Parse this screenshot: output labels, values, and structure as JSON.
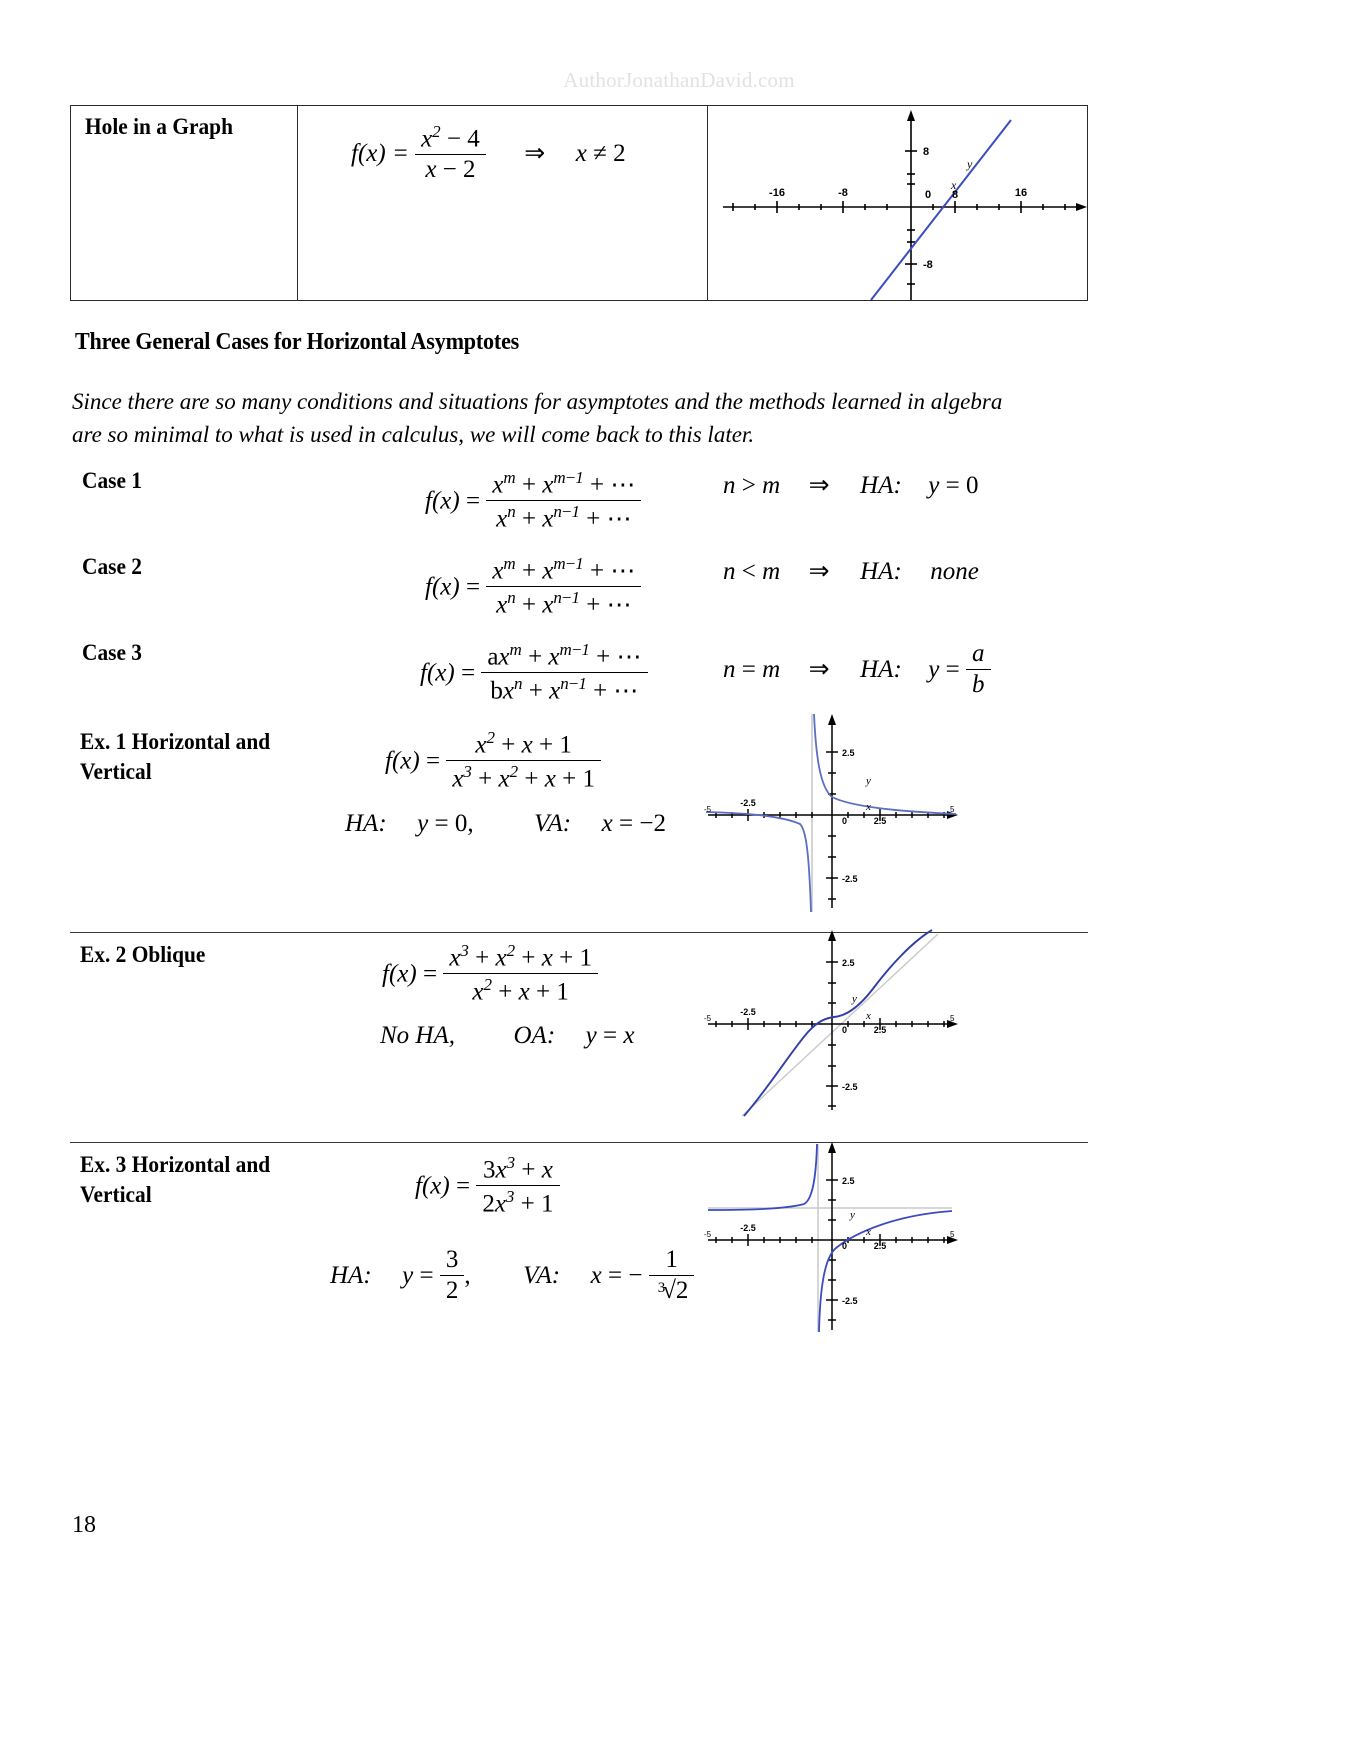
{
  "watermark": "AuthorJonathanDavid.com",
  "page_number": "18",
  "hole_table": {
    "label": "Hole in a Graph",
    "formula": {
      "lhs": "f(x) =",
      "numerator": "x² − 4",
      "denominator": "x − 2",
      "implies": "⇒",
      "condition": "x ≠ 2"
    },
    "graph": {
      "x_ticks": [
        "-16",
        "-8",
        "0",
        "8",
        "16"
      ],
      "y_ticks": [
        "8",
        "-8"
      ],
      "axis_labels": {
        "x": "x",
        "y": "y"
      },
      "curve_color": "#3b4cc0"
    }
  },
  "section": {
    "heading": "Three General Cases for Horizontal Asymptotes",
    "paragraph_line_1": "Since there are so many conditions and situations for asymptotes and the methods learned in algebra",
    "paragraph_line_2": "are so minimal to what is used in calculus, we will come back to this later."
  },
  "cases": [
    {
      "label": "Case 1",
      "numerator": "x^m + x^{m-1} + ⋯",
      "denominator": "x^n + x^{n-1} + ⋯",
      "condition": "n > m",
      "implies": "⇒",
      "ha_label": "HA:",
      "ha_value": "y = 0"
    },
    {
      "label": "Case 2",
      "numerator": "x^m + x^{m-1} + ⋯",
      "denominator": "x^n + x^{n-1} + ⋯",
      "condition": "n < m",
      "implies": "⇒",
      "ha_label": "HA:",
      "ha_value": "none"
    },
    {
      "label": "Case 3",
      "numerator": "ax^m + x^{m-1} + ⋯",
      "denominator": "bx^n + x^{n-1} + ⋯",
      "condition": "n = m",
      "implies": "⇒",
      "ha_label": "HA:",
      "ha_value": "y = a/b"
    }
  ],
  "examples": [
    {
      "label": "Ex. 1 Horizontal and Vertical",
      "numerator": "x² + x + 1",
      "denominator": "x³ + x² + x + 1",
      "result_line": "HA:    y = 0,        VA:    x = −2",
      "ha_label": "HA:",
      "ha_value": "y = 0,",
      "va_label": "VA:",
      "va_value": "x = −2",
      "graph": {
        "x_ticks": [
          "-2.5",
          "0",
          "2.5"
        ],
        "y_ticks": [
          "2.5",
          "-2.5"
        ],
        "axis_labels": {
          "x": "x",
          "y": "y"
        },
        "asymptote_x": -1,
        "curve_color": "#5a6fc0"
      }
    },
    {
      "label": "Ex. 2 Oblique",
      "numerator": "x³ + x² + x + 1",
      "denominator": "x² + x + 1",
      "result_line": "No HA,       OA:    y = x",
      "ha_label": "No HA,",
      "oa_label": "OA:",
      "oa_value": "y = x",
      "graph": {
        "x_ticks": [
          "-2.5",
          "0",
          "2.5"
        ],
        "y_ticks": [
          "2.5",
          "-2.5"
        ],
        "axis_labels": {
          "x": "x",
          "y": "y"
        },
        "oblique": "y = x",
        "curve_color": "#2f3fa8"
      }
    },
    {
      "label": "Ex. 3 Horizontal and Vertical",
      "numerator": "3x³ + x",
      "denominator": "2x³ + 1",
      "ha_label": "HA:",
      "ha_value": "y = 3/2,",
      "va_label": "VA:",
      "va_value": "x = −1/∛2",
      "graph": {
        "x_ticks": [
          "-2.5",
          "0",
          "2.5"
        ],
        "y_ticks": [
          "2.5",
          "-2.5"
        ],
        "axis_labels": {
          "x": "x",
          "y": "y"
        },
        "asymptote_x": -0.79,
        "asymptote_y": 1.5,
        "curve_color": "#3b4cc0"
      }
    }
  ]
}
